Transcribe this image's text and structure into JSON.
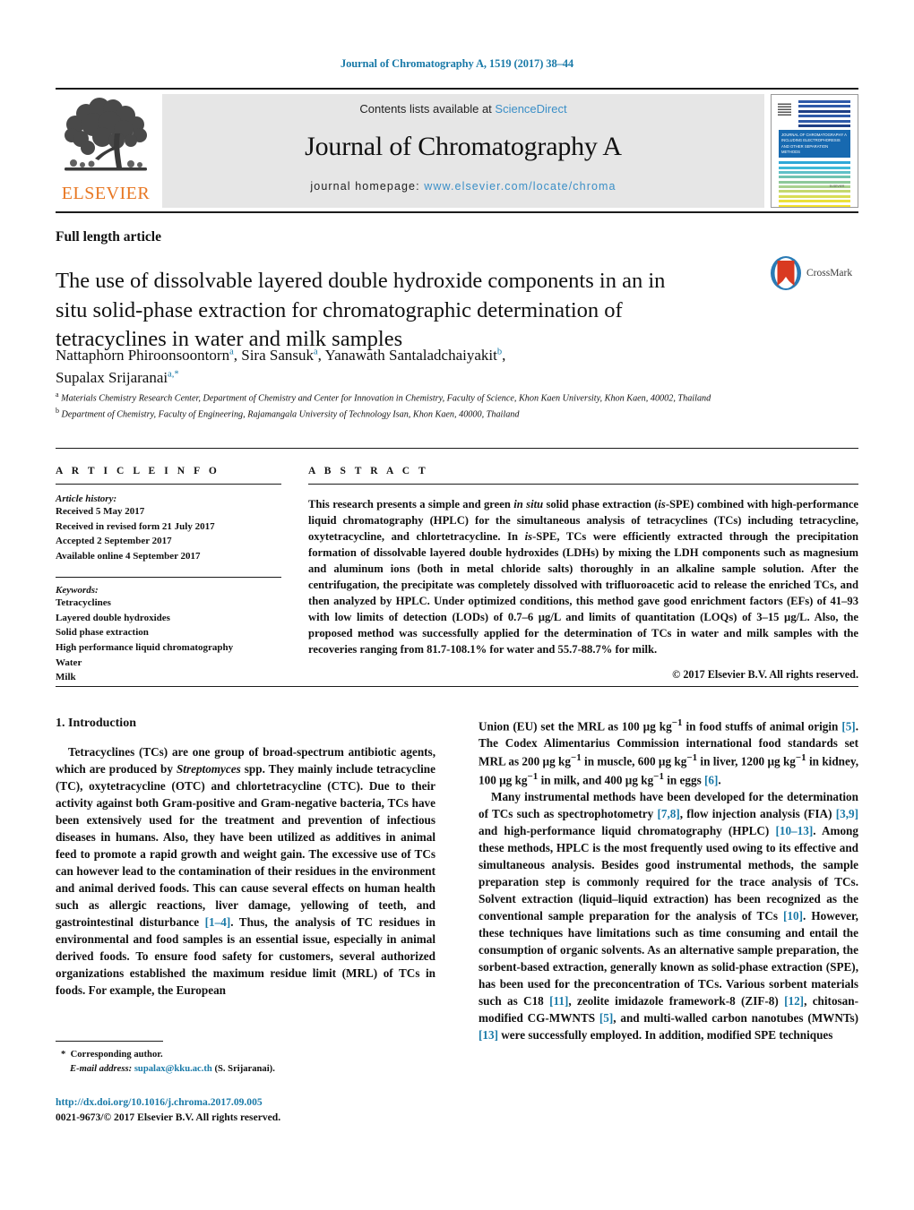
{
  "running_head": "Journal of Chromatography A, 1519 (2017) 38–44",
  "masthead": {
    "publisher_name": "ELSEVIER",
    "contents_prefix": "Contents lists available at ",
    "contents_link": "ScienceDirect",
    "journal_name": "Journal of Chromatography A",
    "homepage_prefix": "journal homepage: ",
    "homepage_url": "www.elsevier.com/locate/chroma",
    "cover_title": "JOURNAL OF CHROMATOGRAPHY A",
    "cover_subtitle": "INCLUDING ELECTROPHORESIS AND OTHER SEPARATION METHODS",
    "cover_footer": "ELSEVIER",
    "cover_bar_colors": [
      "#2f5aa8",
      "#2f5aa8",
      "#1f3f85",
      "#2f5aa8",
      "#2f5aa8",
      "#1f3f85",
      "#2fa8d8",
      "#3fb8d8",
      "#5fc0c8",
      "#6fc3b0",
      "#8ec99a",
      "#a9d18e",
      "#c4d870",
      "#d9dd55",
      "#ebe13c",
      "#f3e12a",
      "#f6d423",
      "#f7c41f",
      "#f5ad1c",
      "#f2971b",
      "#ef801a",
      "#ec6a19",
      "#e85a1c",
      "#e44f24",
      "#e0452f",
      "#dd5a4a"
    ]
  },
  "article_type": "Full length article",
  "title": "The use of dissolvable layered double hydroxide components in an in situ solid-phase extraction for chromatographic determination of tetracyclines in water and milk samples",
  "crossmark_label": "CrossMark",
  "authors_line1_a": "Nattaphorn Phiroonsoontorn",
  "authors_line1_a_sup": "a",
  "authors_line1_b": "Sira Sansuk",
  "authors_line1_b_sup": "a",
  "authors_line1_c": "Yanawath Santaladchaiyakit",
  "authors_line1_c_sup": "b",
  "authors_line2": "Supalax Srijaranai",
  "authors_line2_sup": "a,*",
  "affiliation_a_sup": "a",
  "affiliation_a": "Materials Chemistry Research Center, Department of Chemistry and Center for Innovation in Chemistry, Faculty of Science, Khon Kaen University, Khon Kaen, 40002, Thailand",
  "affiliation_b_sup": "b",
  "affiliation_b": "Department of Chemistry, Faculty of Engineering, Rajamangala University of Technology Isan, Khon Kaen, 40000, Thailand",
  "article_info": {
    "heading": "A R T I C L E   I N F O",
    "history_label": "Article history:",
    "history": [
      "Received 5 May 2017",
      "Received in revised form 21 July 2017",
      "Accepted 2 September 2017",
      "Available online 4 September 2017"
    ],
    "keywords_label": "Keywords:",
    "keywords": [
      "Tetracyclines",
      "Layered double hydroxides",
      "Solid phase extraction",
      "High performance liquid chromatography",
      "Water",
      "Milk"
    ]
  },
  "abstract": {
    "heading": "A B S T R A C T",
    "part1": "This research presents a simple and green ",
    "italic1": "in situ",
    "part2": " solid phase extraction (",
    "italic2": "is",
    "part3": "-SPE) combined with high-performance liquid chromatography (HPLC) for the simultaneous analysis of tetracyclines (TCs) including tetracycline, oxytetracycline, and chlortetracycline. In ",
    "italic3": "is",
    "part4": "-SPE, TCs were efficiently extracted through the precipitation formation of dissolvable layered double hydroxides (LDHs) by mixing the LDH components such as magnesium and aluminum ions (both in metal chloride salts) thoroughly in an alkaline sample solution. After the centrifugation, the precipitate was completely dissolved with trifluoroacetic acid to release the enriched TCs, and then analyzed by HPLC. Under optimized conditions, this method gave good enrichment factors (EFs) of 41–93 with low limits of detection (LODs) of 0.7–6 µg/L and limits of quantitation (LOQs) of 3–15 µg/L. Also, the proposed method was successfully applied for the determination of TCs in water and milk samples with the recoveries ranging from 81.7-108.1% for water and 55.7-88.7% for milk.",
    "copyright": "© 2017 Elsevier B.V. All rights reserved."
  },
  "introduction": {
    "section_title": "1.  Introduction",
    "p1_a": "Tetracyclines (TCs) are one group of broad-spectrum antibiotic agents, which are produced by ",
    "p1_italic": "Streptomyces",
    "p1_b": " spp. They mainly include tetracycline (TC), oxytetracycline (OTC) and chlortetracycline (CTC). Due to their activity against both Gram-positive and Gram-negative bacteria, TCs have been extensively used for the treatment and prevention of infectious diseases in humans. Also, they have been utilized as additives in animal feed to promote a rapid growth and weight gain. The excessive use of TCs can however lead to the contamination of their residues in the environment and animal derived foods. This can cause several effects on human health such as allergic reactions, liver damage, yellowing of teeth, and gastrointestinal disturbance ",
    "p1_ref1": "[1–4]",
    "p1_c": ". Thus, the analysis of TC residues in environmental and food samples is an essential issue, especially in animal derived foods. To ensure food safety for customers, several authorized organizations established the maximum residue limit (MRL) of TCs in foods. For example, the European",
    "p2_a": "Union (EU) set the MRL as 100 µg kg",
    "p2_sup1": "−1",
    "p2_b": " in food stuffs of animal origin ",
    "p2_ref1": "[5]",
    "p2_c": ". The Codex Alimentarius Commission international food standards set MRL as 200 µg kg",
    "p2_sup2": "−1",
    "p2_d": " in muscle, 600 µg kg",
    "p2_sup3": "−1",
    "p2_e": " in liver, 1200 µg kg",
    "p2_sup4": "−1",
    "p2_f": " in kidney, 100 µg kg",
    "p2_sup5": "−1",
    "p2_g": " in milk, and 400 µg kg",
    "p2_sup6": "−1",
    "p2_h": " in eggs ",
    "p2_ref2": "[6]",
    "p2_i": ".",
    "p3_a": "Many instrumental methods have been developed for the determination of TCs such as spectrophotometry ",
    "p3_ref1": "[7,8]",
    "p3_b": ", flow injection analysis (FIA) ",
    "p3_ref2": "[3,9]",
    "p3_c": " and high-performance liquid chromatography (HPLC) ",
    "p3_ref3": "[10–13]",
    "p3_d": ". Among these methods, HPLC is the most frequently used owing to its effective and simultaneous analysis. Besides good instrumental methods, the sample preparation step is commonly required for the trace analysis of TCs. Solvent extraction (liquid–liquid extraction) has been recognized as the conventional sample preparation for the analysis of TCs ",
    "p3_ref4": "[10]",
    "p3_e": ". However, these techniques have limitations such as time consuming and entail the consumption of organic solvents. As an alternative sample preparation, the sorbent-based extraction, generally known as solid-phase extraction (SPE), has been used for the preconcentration of TCs. Various sorbent materials such as C18 ",
    "p3_ref5": "[11]",
    "p3_f": ", zeolite imidazole framework-8 (ZIF-8) ",
    "p3_ref6": "[12]",
    "p3_g": ", chitosan-modified CG-MWNTS ",
    "p3_ref7": "[5]",
    "p3_h": ", and multi-walled carbon nanotubes (MWNTs) ",
    "p3_ref8": "[13]",
    "p3_i": " were successfully employed. In addition, modified SPE techniques"
  },
  "footnote": {
    "star": "*",
    "corresponding": "Corresponding author.",
    "email_label": "E-mail address:",
    "email": "supalax@kku.ac.th",
    "email_suffix": " (S. Srijaranai)."
  },
  "doi": "http://dx.doi.org/10.1016/j.chroma.2017.09.005",
  "issn_line": "0021-9673/© 2017 Elsevier B.V. All rights reserved."
}
